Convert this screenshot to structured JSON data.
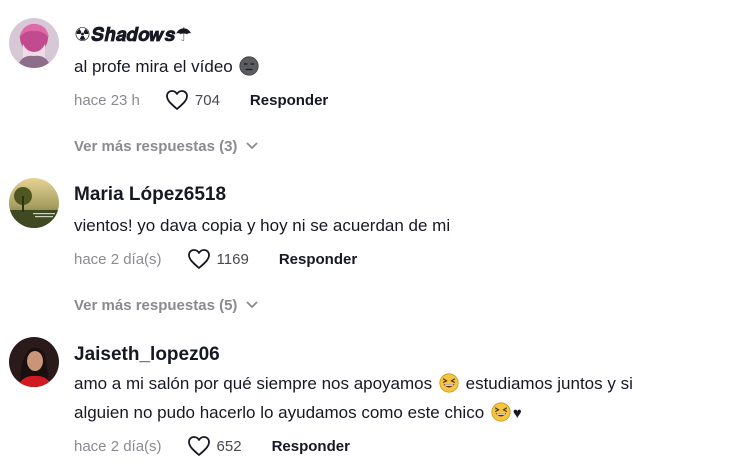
{
  "comments": [
    {
      "username": "☢𝑺𝒉𝒂𝒅𝒐𝒘𝒔☂",
      "text_before": "al profe mira el vídeo",
      "emoji": "expressionless-face",
      "time": "hace 23 h",
      "likes": "704",
      "reply_label": "Responder",
      "more_replies": "Ver más respuestas (3)"
    },
    {
      "username": "Maria López6518",
      "text_before": "vientos! yo dava copia y hoy ni se acuerdan de mi",
      "time": "hace 2 día(s)",
      "likes": "1169",
      "reply_label": "Responder",
      "more_replies": "Ver más respuestas (5)"
    },
    {
      "username": "Jaiseth_lopez06",
      "text_part1": "amo a mi salón por qué siempre nos apoyamos",
      "text_part2": "estudiamos juntos y si alguien no pudo hacerlo lo ayudamos como este chico",
      "text_end": "♥",
      "emoji": "grinning-squinting-face",
      "time": "hace 2 día(s)",
      "likes": "652",
      "reply_label": "Responder"
    }
  ],
  "colors": {
    "text_primary": "#161823",
    "text_secondary": "#8a8b91",
    "background": "#ffffff"
  }
}
